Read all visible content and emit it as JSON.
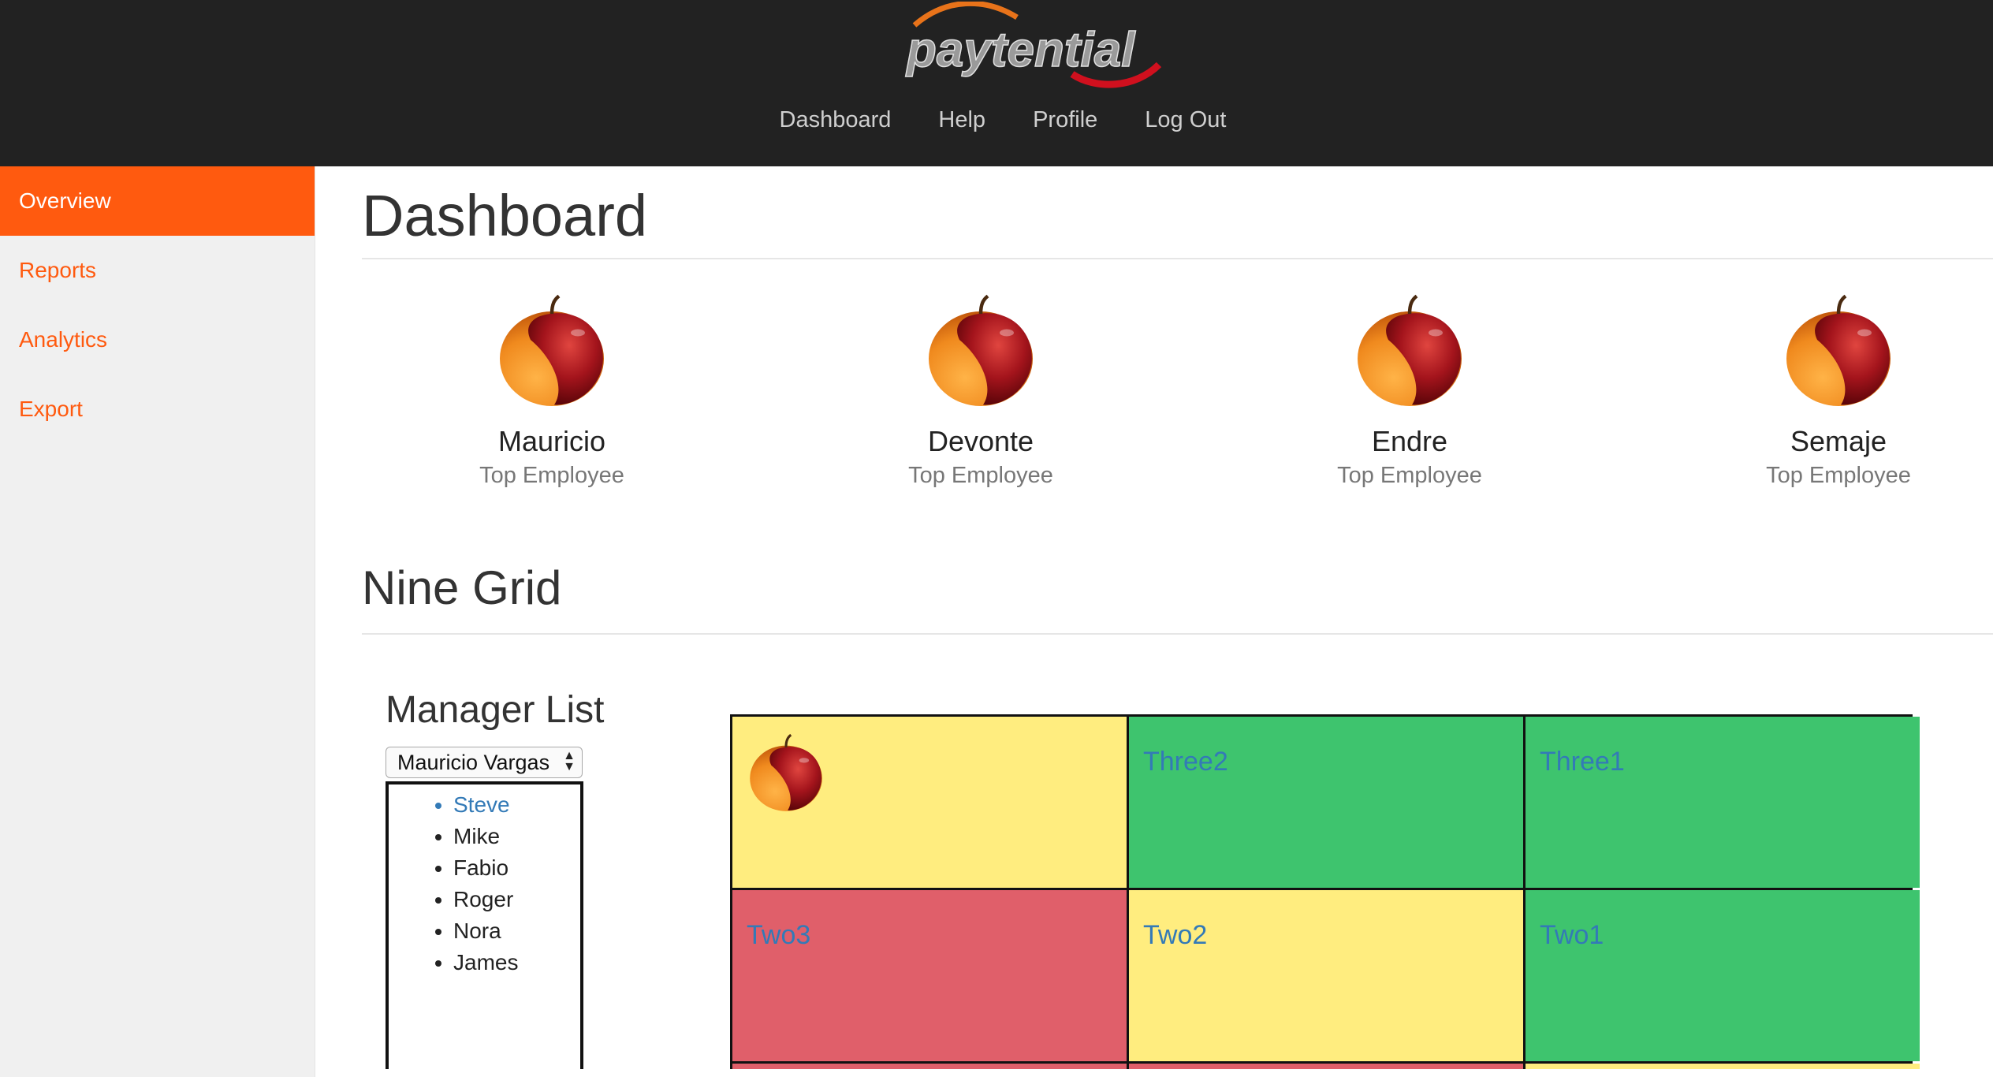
{
  "header": {
    "logo_text": "paytential",
    "nav": [
      "Dashboard",
      "Help",
      "Profile",
      "Log Out"
    ]
  },
  "sidebar": {
    "items": [
      {
        "label": "Overview",
        "active": true
      },
      {
        "label": "Reports",
        "active": false
      },
      {
        "label": "Analytics",
        "active": false
      },
      {
        "label": "Export",
        "active": false
      }
    ]
  },
  "main": {
    "title": "Dashboard",
    "employees": [
      {
        "name": "Mauricio",
        "role": "Top Employee"
      },
      {
        "name": "Devonte",
        "role": "Top Employee"
      },
      {
        "name": "Endre",
        "role": "Top Employee"
      },
      {
        "name": "Semaje",
        "role": "Top Employee"
      }
    ],
    "nine_grid_title": "Nine Grid",
    "manager_list": {
      "title": "Manager List",
      "selected": "Mauricio Vargas",
      "members": [
        "Steve",
        "Mike",
        "Fabio",
        "Roger",
        "Nora",
        "James"
      ]
    },
    "grid": {
      "cells": [
        {
          "label": "",
          "color": "yellow",
          "has_image": true
        },
        {
          "label": "Three2",
          "color": "green"
        },
        {
          "label": "Three1",
          "color": "green"
        },
        {
          "label": "Two3",
          "color": "red"
        },
        {
          "label": "Two2",
          "color": "yellow"
        },
        {
          "label": "Two1",
          "color": "green"
        }
      ]
    }
  },
  "colors": {
    "accent": "#ff5a0f",
    "header_bg": "#222222",
    "link": "#337ab7",
    "cell_yellow": "#ffed7f",
    "cell_green": "#3ec46e",
    "cell_red": "#e05f6a"
  }
}
